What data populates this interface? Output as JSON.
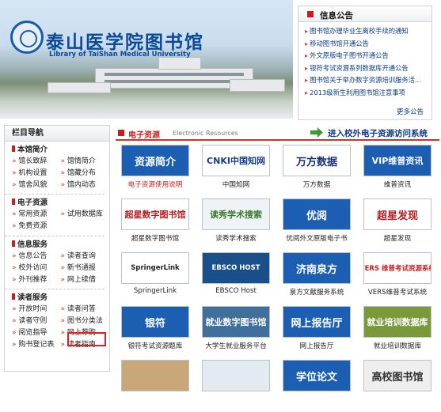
{
  "banner": {
    "title": "泰山医学院图书馆",
    "subtitle": "Library of TaiShan Medical University"
  },
  "announcements": {
    "title": "信息公告",
    "more": "更多公告",
    "items": [
      "图书馆办理毕业生离校手续的通知",
      "移动图书馆开通公告",
      "外文原版电子图书开通公告",
      "银符考试资源系列数据库开通公告",
      "图书馆关于举办数字资源培训服务活...",
      "2013级新生利用图书馆注意事项"
    ]
  },
  "sidebar": {
    "title": "栏目导航",
    "sections": [
      {
        "title": "本馆简介",
        "rows": [
          [
            "馆长致辞",
            "馆情简介"
          ],
          [
            "机构设置",
            "馆藏分布"
          ],
          [
            "馆舍风貌",
            "馆内动态"
          ]
        ]
      },
      {
        "title": "电子资源",
        "rows": [
          [
            "常用资源",
            "试用数据库"
          ],
          [
            "免费资源",
            ""
          ]
        ]
      },
      {
        "title": "信息服务",
        "rows": [
          [
            "信息公告",
            "读者查询"
          ],
          [
            "校外访问",
            "新书通报"
          ],
          [
            "外刊推荐",
            "网上续借"
          ]
        ]
      },
      {
        "title": "读者服务",
        "rows": [
          [
            "开放时间",
            "读者问答"
          ],
          [
            "读者守则",
            "图书分类法"
          ],
          [
            "阅览指导",
            "网上荐购"
          ],
          [
            "购书登记表",
            "读者指南"
          ]
        ]
      }
    ]
  },
  "main": {
    "title": "电子资源",
    "title_en": "Electronic Resources",
    "link": "进入校外电子资源访问系统",
    "tiles": [
      {
        "label": "资源简介",
        "caption": "电子资源使用说明",
        "bg": "#1c5fb2",
        "fg": "#ffffff",
        "red": true
      },
      {
        "label": "CNKI中国知网",
        "caption": "中国知网",
        "bg": "#ffffff",
        "fg": "#1a3d8a",
        "red": false
      },
      {
        "label": "万方数据",
        "caption": "万方数据",
        "bg": "#ffffff",
        "fg": "#16307a",
        "red": false
      },
      {
        "label": "VIP维普资讯",
        "caption": "维普资讯",
        "bg": "#1c5fb2",
        "fg": "#ffffff",
        "red": false
      },
      {
        "label": "超星数字图书馆",
        "caption": "超星数字图书馆",
        "bg": "#ffffff",
        "fg": "#b81c1c",
        "red": false
      },
      {
        "label": "读秀学术搜索",
        "caption": "读秀学术搜索",
        "bg": "#eef3f8",
        "fg": "#3a7a2a",
        "red": false
      },
      {
        "label": "优阅",
        "caption": "优阅外文原版电子书",
        "bg": "#1c5fb2",
        "fg": "#ffffff",
        "red": false
      },
      {
        "label": "超星发现",
        "caption": "超星发现",
        "bg": "#ffffff",
        "fg": "#b81c1c",
        "red": false
      },
      {
        "label": "SpringerLink",
        "caption": "SpringerLink",
        "bg": "#ffffff",
        "fg": "#222222",
        "red": false
      },
      {
        "label": "EBSCO HOST",
        "caption": "EBSCO Host",
        "bg": "#1a4f8a",
        "fg": "#ffffff",
        "red": false
      },
      {
        "label": "济南泉方",
        "caption": "泉方文献服务系统",
        "bg": "#1c5fb2",
        "fg": "#ffffff",
        "red": false
      },
      {
        "label": "VERS 维普考试资源系统",
        "caption": "VERS维普考试系统",
        "bg": "#ffffff",
        "fg": "#c81e1e",
        "red": false
      },
      {
        "label": "银符",
        "caption": "银符考试资源题库",
        "bg": "#1c5fb2",
        "fg": "#ffffff",
        "red": false
      },
      {
        "label": "就业数字图书馆",
        "caption": "大学生就业服务平台",
        "bg": "#3f6f9a",
        "fg": "#ffffff",
        "red": false
      },
      {
        "label": "网上报告厅",
        "caption": "网上报告厅",
        "bg": "#1c5fb2",
        "fg": "#ffffff",
        "red": false
      },
      {
        "label": "就业培训数据库",
        "caption": "就业培训数据库",
        "bg": "#7a9a3a",
        "fg": "#ffffff",
        "red": false
      },
      {
        "label": "",
        "caption": "",
        "bg": "#c8a878",
        "fg": "#ffffff",
        "red": false
      },
      {
        "label": "",
        "caption": "",
        "bg": "#e3eaf2",
        "fg": "#1a3d8a",
        "red": false
      },
      {
        "label": "学位论文",
        "caption": "",
        "bg": "#1c5fb2",
        "fg": "#ffffff",
        "red": false
      },
      {
        "label": "高校图书馆",
        "caption": "",
        "bg": "#eeeeee",
        "fg": "#333333",
        "red": false
      }
    ]
  }
}
